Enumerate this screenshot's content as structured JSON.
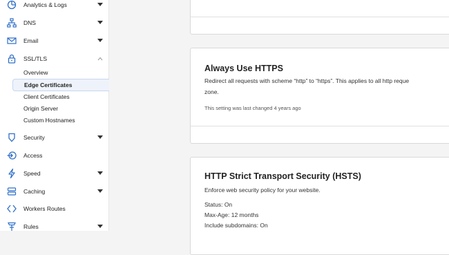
{
  "sidebar": {
    "items": [
      {
        "label": "Analytics & Logs",
        "icon": "analytics-icon",
        "caret": "down"
      },
      {
        "label": "DNS",
        "icon": "dns-icon",
        "caret": "down"
      },
      {
        "label": "Email",
        "icon": "email-icon",
        "caret": "down"
      },
      {
        "label": "SSL/TLS",
        "icon": "lock-icon",
        "caret": "up"
      },
      {
        "label": "Security",
        "icon": "shield-icon",
        "caret": "down"
      },
      {
        "label": "Access",
        "icon": "access-icon",
        "caret": ""
      },
      {
        "label": "Speed",
        "icon": "lightning-icon",
        "caret": "down"
      },
      {
        "label": "Caching",
        "icon": "caching-icon",
        "caret": "down"
      },
      {
        "label": "Workers Routes",
        "icon": "workers-icon",
        "caret": ""
      },
      {
        "label": "Rules",
        "icon": "rules-icon",
        "caret": "down"
      }
    ],
    "ssl_subitems": [
      {
        "label": "Overview",
        "active": false
      },
      {
        "label": "Edge Certificates",
        "active": true
      },
      {
        "label": "Client Certificates",
        "active": false
      },
      {
        "label": "Origin Server",
        "active": false
      },
      {
        "label": "Custom Hostnames",
        "active": false
      }
    ]
  },
  "main": {
    "always_https": {
      "title": "Always Use HTTPS",
      "description_line1": "Redirect all requests with scheme “http” to “https”. This applies to all http reque",
      "description_line2": "zone.",
      "last_changed": "This setting was last changed 4 years ago"
    },
    "hsts": {
      "title": "HTTP Strict Transport Security (HSTS)",
      "description": "Enforce web security policy for your website.",
      "status": "Status: On",
      "max_age": "Max-Age: 12 months",
      "include_subdomains": "Include subdomains: On"
    }
  },
  "colors": {
    "accent": "#2f6fc8",
    "active_bg": "#eef3fb"
  }
}
